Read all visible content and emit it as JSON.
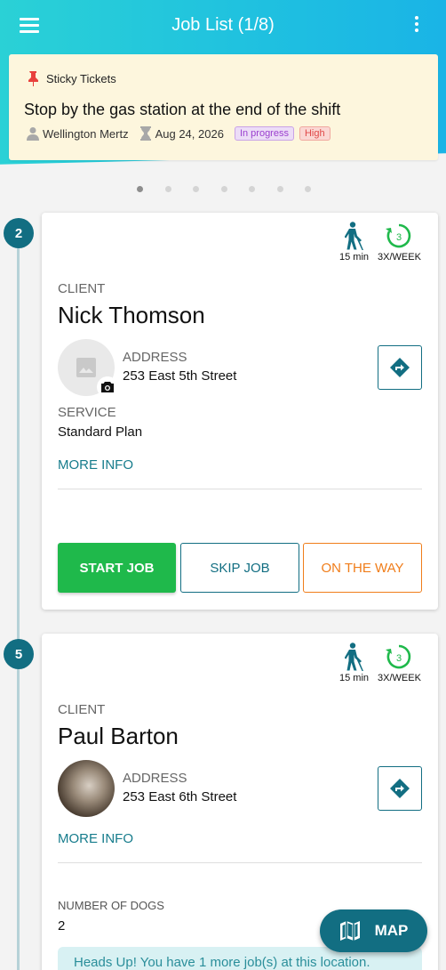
{
  "header": {
    "title": "Job List (1/8)"
  },
  "sticky": {
    "label": "Sticky Tickets",
    "text": "Stop by the gas station at the end of the shift",
    "assignee": "Wellington Mertz",
    "date": "Aug 24, 2026",
    "status": "In progress",
    "priority": "High"
  },
  "pager": {
    "count": 7,
    "active": 0
  },
  "jobs": [
    {
      "step": "2",
      "duration": "15 min",
      "frequency_count": "3",
      "frequency": "3X/WEEK",
      "client_label": "CLIENT",
      "client_name": "Nick Thomson",
      "address_label": "ADDRESS",
      "address": "253 East 5th Street",
      "service_label": "SERVICE",
      "service": "Standard Plan",
      "more_info": "MORE INFO",
      "start_label": "START JOB",
      "skip_label": "SKIP JOB",
      "way_label": "ON THE WAY"
    },
    {
      "step": "5",
      "duration": "15 min",
      "frequency_count": "3",
      "frequency": "3X/WEEK",
      "client_label": "CLIENT",
      "client_name": "Paul Barton",
      "address_label": "ADDRESS",
      "address": "253 East 6th Street",
      "more_info": "MORE INFO",
      "dogs_label": "NUMBER OF DOGS",
      "dogs": "2",
      "notice": "Heads Up! You have 1 more job(s) at this location."
    }
  ],
  "fab": {
    "label": "MAP"
  },
  "colors": {
    "primary": "#126e82",
    "start": "#1fb94b",
    "way": "#f07d1a",
    "header": "#1fc0e0"
  }
}
